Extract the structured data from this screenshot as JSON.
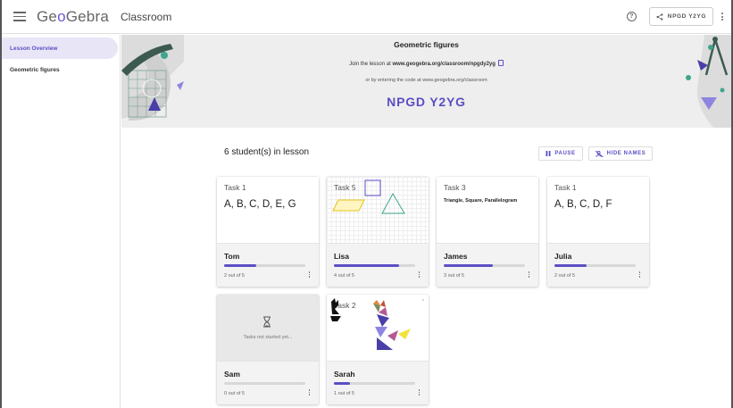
{
  "topbar": {
    "brand_prefix": "Ge",
    "brand_o": "o",
    "brand_suffix": "Gebra",
    "app_name": "Classroom",
    "help_label": "?",
    "share_code": "NPGD Y2YG"
  },
  "sidebar": {
    "items": [
      {
        "label": "Lesson Overview",
        "active": true
      },
      {
        "label": "Geometric figures",
        "active": false
      }
    ]
  },
  "banner": {
    "title": "Geometric figures",
    "join_prefix": "Join the lesson at ",
    "join_url": "www.geogebra.org/classroom/npgdy2yg",
    "or_text": "or by entering the code at www.geogebra.org/classroom",
    "code": "NPGD Y2YG"
  },
  "lesson": {
    "student_count_text": "6 student(s) in lesson",
    "pause_label": "PAUSE",
    "hide_names_label": "HIDE NAMES"
  },
  "colors": {
    "accent": "#5a4fc4",
    "banner_bg": "#eeeeee",
    "footer_bg": "#f3f3f3"
  },
  "students": [
    {
      "name": "Tom",
      "task": "Task 1",
      "answer": "A, B, C, D, E, G",
      "progress_text": "2 out of 5",
      "progress": 0.4
    },
    {
      "name": "Lisa",
      "task": "Task 5",
      "answer": "",
      "progress_text": "4 out of 5",
      "progress": 0.8
    },
    {
      "name": "James",
      "task": "Task 3",
      "answer": "Triangle, Square, Parallelogram",
      "progress_text": "3 out of 5",
      "progress": 0.6
    },
    {
      "name": "Julia",
      "task": "Task 1",
      "answer": "A, B, C, D, F",
      "progress_text": "2 out of 5",
      "progress": 0.4
    },
    {
      "name": "Sam",
      "task": "",
      "answer": "Tasks not started yet...",
      "progress_text": "0 out of 5",
      "progress": 0.0
    },
    {
      "name": "Sarah",
      "task": "Task 2",
      "answer": "",
      "progress_text": "1 out of 5",
      "progress": 0.2
    }
  ]
}
